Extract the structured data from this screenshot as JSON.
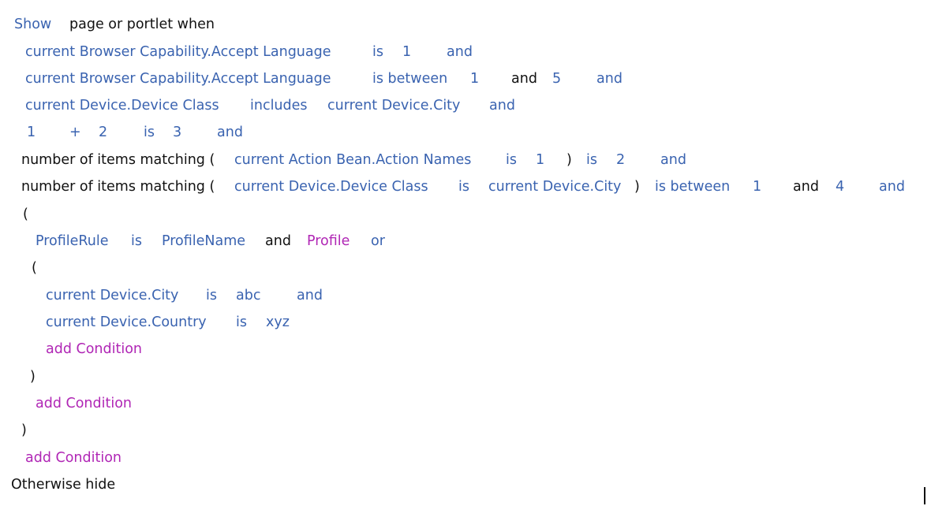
{
  "header": {
    "show": "Show",
    "rest": "page or portlet when"
  },
  "c1": {
    "subject": "current Browser Capability.Accept Language",
    "op": "is",
    "value": "1",
    "conj": "and"
  },
  "c2": {
    "subject": "current Browser Capability.Accept Language",
    "op": "is between",
    "v1": "1",
    "and_between": "and",
    "v2": "5",
    "conj": "and"
  },
  "c3": {
    "subject": "current Device.Device Class",
    "op": "includes",
    "value": "current Device.City",
    "conj": "and"
  },
  "c4": {
    "a": "1",
    "plus": "+",
    "b": "2",
    "op": "is",
    "value": "3",
    "conj": "and"
  },
  "c5": {
    "prefix": "number of items matching (",
    "subject": "current Action Bean.Action Names",
    "op": "is",
    "value": "1",
    "close": ")",
    "op2": "is",
    "value2": "2",
    "conj": "and"
  },
  "c6": {
    "prefix": "number of items matching (",
    "subject": "current Device.Device Class",
    "op": "is",
    "value": "current Device.City",
    "close": ")",
    "op2": "is between",
    "v1": "1",
    "and_between": "and",
    "v2": "4",
    "conj": "and"
  },
  "group1": {
    "open": "(",
    "rule": {
      "subject": "ProfileRule",
      "op": "is",
      "value": "ProfileName",
      "and_word": "and",
      "profile": "Profile",
      "conj": "or"
    },
    "group2": {
      "open": "(",
      "c1": {
        "subject": "current Device.City",
        "op": "is",
        "value": "abc",
        "conj": "and"
      },
      "c2": {
        "subject": "current Device.Country",
        "op": "is",
        "value": "xyz"
      },
      "add": "add Condition",
      "close": ")"
    },
    "add": "add Condition",
    "close": ")"
  },
  "add": "add Condition",
  "footer": "Otherwise hide"
}
